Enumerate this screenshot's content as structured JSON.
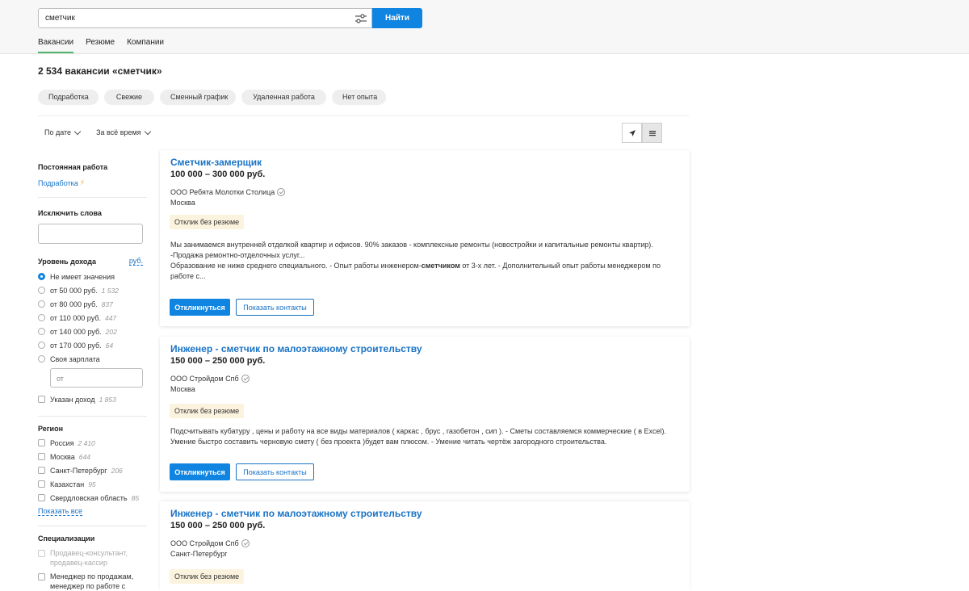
{
  "search": {
    "value": "сметчик",
    "button_label": "Найти"
  },
  "tabs": [
    {
      "label": "Вакансии"
    },
    {
      "label": "Резюме"
    },
    {
      "label": "Компании"
    }
  ],
  "results_title": "2 534 вакансии «сметчик»",
  "chips": [
    "Подработка",
    "Свежие",
    "Сменный график",
    "Удаленная работа",
    "Нет опыта"
  ],
  "sort": {
    "by_date": "По дате",
    "all_time": "За всё время"
  },
  "view_switch": {
    "map_icon": "navigation-arrow-icon",
    "list_icon": "list-icon"
  },
  "sidebar": {
    "permanent": {
      "title": "Постоянная работа",
      "link": "Подработка"
    },
    "exclude": {
      "title": "Исключить слова"
    },
    "income": {
      "title": "Уровень дохода",
      "currency": "руб.",
      "options": [
        {
          "label": "Не имеет значения",
          "count": ""
        },
        {
          "label": "от 50 000 руб.",
          "count": "1 532"
        },
        {
          "label": "от 80 000 руб.",
          "count": "837"
        },
        {
          "label": "от 110 000 руб.",
          "count": "447"
        },
        {
          "label": "от 140 000 руб.",
          "count": "202"
        },
        {
          "label": "от 170 000 руб.",
          "count": "64"
        },
        {
          "label": "Своя зарплата",
          "count": ""
        }
      ],
      "own_placeholder": "от",
      "income_shown": {
        "label": "Указан доход",
        "count": "1 853"
      }
    },
    "region": {
      "title": "Регион",
      "items": [
        {
          "label": "Россия",
          "count": "2 410"
        },
        {
          "label": "Москва",
          "count": "644"
        },
        {
          "label": "Санкт-Петербург",
          "count": "206"
        },
        {
          "label": "Казахстан",
          "count": "95"
        },
        {
          "label": "Свердловская область",
          "count": "85"
        }
      ],
      "show_all": "Показать все"
    },
    "spec": {
      "title": "Специализации",
      "items": [
        {
          "label1": "Продавец-консультант,",
          "label2": "продавец-кассир"
        },
        {
          "label1": "Менеджер по продажам,",
          "label2": "менеджер по работе с"
        }
      ]
    }
  },
  "vacancies": [
    {
      "title": "Сметчик-замерщик",
      "salary": "100 000 – 300 000 руб.",
      "company": "ООО Ребята Молотки Столица",
      "city": "Москва",
      "badge": "Отклик без резюме",
      "desc1": "Мы занимаемся внутренней отделкой квартир и офисов. 90% заказов - комплексные ремонты (новостройки и капитальные ремонты квартир).",
      "desc2": "-Продажа ремонтно-отделочных услуг...",
      "desc3a": "Образование не ниже среднего специального. - Опыт работы инженером-",
      "desc3b": "сметчиком",
      "desc3c": " от 3-х лет. - Дополнительный опыт работы менеджером по",
      "desc4": "работе с...",
      "respond": "Откликнуться",
      "contacts": "Показать контакты"
    },
    {
      "title": "Инженер - сметчик по малоэтажному строительству",
      "salary": "150 000 – 250 000 руб.",
      "company": "ООО Стройдом Спб",
      "city": "Москва",
      "badge": "Отклик без резюме",
      "desc1": "Подсчитывать кубатуру , цены и работу на все виды материалов ( каркас , брус , газобетон , сип ). - Сметы составляемся коммерческие ( в Excel).",
      "desc2": "Умение быстро составить черновую смету ( без проекта )будет вам плюсом. - Умение читать чертёж загородного строительства.",
      "respond": "Откликнуться",
      "contacts": "Показать контакты"
    },
    {
      "title": "Инженер - сметчик по малоэтажному строительству",
      "salary": "150 000 – 250 000 руб.",
      "company": "ООО Стройдом Спб",
      "city": "Санкт-Петербург",
      "badge": "Отклик без резюме"
    }
  ]
}
